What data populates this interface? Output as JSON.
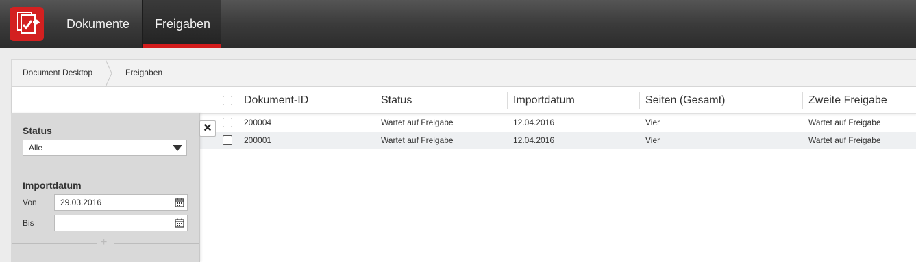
{
  "nav": {
    "items": [
      {
        "label": "Dokumente"
      },
      {
        "label": "Freigaben"
      }
    ],
    "active": "Freigaben",
    "accent": "#d31c1c"
  },
  "breadcrumb": [
    "Document Desktop",
    "Freigaben"
  ],
  "table": {
    "columns": [
      "Dokument-ID",
      "Status",
      "Importdatum",
      "Seiten (Gesamt)",
      "Zweite Freigabe"
    ],
    "rows": [
      {
        "id": "200004",
        "status": "Wartet auf Freigabe",
        "date": "12.04.2016",
        "pages": "Vier",
        "second": "Wartet auf Freigabe"
      },
      {
        "id": "200001",
        "status": "Wartet auf Freigabe",
        "date": "12.04.2016",
        "pages": "Vier",
        "second": "Wartet auf Freigabe"
      }
    ]
  },
  "filter": {
    "status_heading": "Status",
    "status_value": "Alle",
    "import_heading": "Importdatum",
    "from_label": "Von",
    "from_value": "29.03.2016",
    "to_label": "Bis",
    "to_value": ""
  },
  "icons": {
    "logo": "document-approval-logo",
    "close": "close-icon",
    "calendar": "calendar-icon",
    "plus": "plus-icon"
  }
}
